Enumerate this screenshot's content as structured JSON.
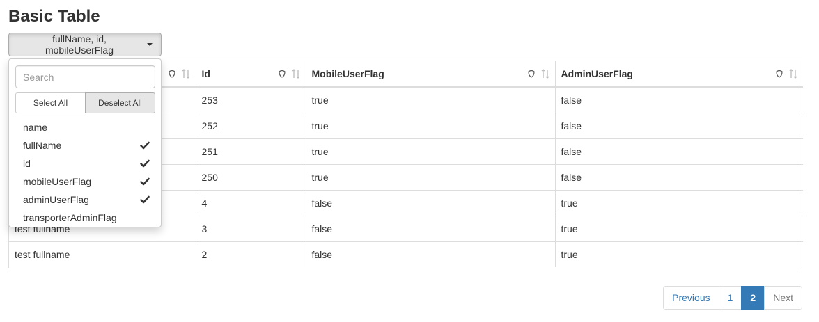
{
  "page": {
    "title": "Basic Table"
  },
  "columns_toggle": {
    "label": "fullName, id, mobileUserFlag"
  },
  "table": {
    "headers": [
      "",
      "Id",
      "MobileUserFlag",
      "AdminUserFlag"
    ],
    "rows": [
      [
        "",
        "253",
        "true",
        "false"
      ],
      [
        "",
        "252",
        "true",
        "false"
      ],
      [
        "",
        "251",
        "true",
        "false"
      ],
      [
        "",
        "250",
        "true",
        "false"
      ],
      [
        "",
        "4",
        "false",
        "true"
      ],
      [
        "test fullname",
        "3",
        "false",
        "true"
      ],
      [
        "test fullname",
        "2",
        "false",
        "true"
      ]
    ]
  },
  "dropdown": {
    "search_placeholder": "Search",
    "select_all": "Select All",
    "deselect_all": "Deselect All",
    "items": [
      {
        "label": "name",
        "checked": false
      },
      {
        "label": "fullName",
        "checked": true
      },
      {
        "label": "id",
        "checked": true
      },
      {
        "label": "mobileUserFlag",
        "checked": true
      },
      {
        "label": "adminUserFlag",
        "checked": true
      },
      {
        "label": "transporterAdminFlag",
        "checked": false
      }
    ]
  },
  "pagination": {
    "previous": "Previous",
    "pages": [
      "1",
      "2"
    ],
    "active_page": "2",
    "next": "Next"
  },
  "colors": {
    "accent": "#337ab7",
    "border": "#dddddd"
  },
  "icons": {
    "filter": "filter-icon",
    "sort": "sort-icon",
    "check": "check-icon"
  }
}
